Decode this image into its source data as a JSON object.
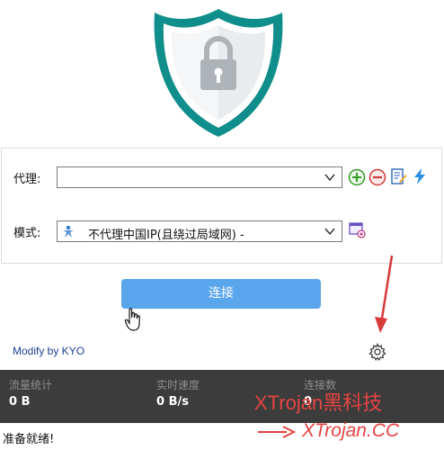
{
  "proxy": {
    "label": "代理:",
    "value": ""
  },
  "mode": {
    "label": "模式:",
    "value": "不代理中国IP(且绕过局域网) -"
  },
  "connect": {
    "label": "连接"
  },
  "footer": {
    "modify_text": "Modify by KYO"
  },
  "stats": [
    {
      "label": "流量统计",
      "value": "0 B"
    },
    {
      "label": "实时速度",
      "value": "0 B/s"
    },
    {
      "label": "连接数",
      "value": "0"
    }
  ],
  "status": {
    "text": "准备就绪!"
  },
  "watermark": {
    "line1": "XTrojan黑科技",
    "line2": "XTrojan.CC"
  },
  "icons": {
    "logo": "shield-lock-icon",
    "add": "plus-circle-icon",
    "remove": "minus-circle-icon",
    "edit": "edit-note-icon",
    "test": "lightning-icon",
    "mode_edit": "rule-edit-icon",
    "settings": "gear-icon",
    "mode_option": "globe-person-icon"
  },
  "colors": {
    "shield": "#0f8e8b",
    "lock": "#aeb3b8",
    "button": "#5aa6ec",
    "stats_bg": "#3c3c3c",
    "watermark": "#e64444",
    "link": "#1b3f8f"
  }
}
